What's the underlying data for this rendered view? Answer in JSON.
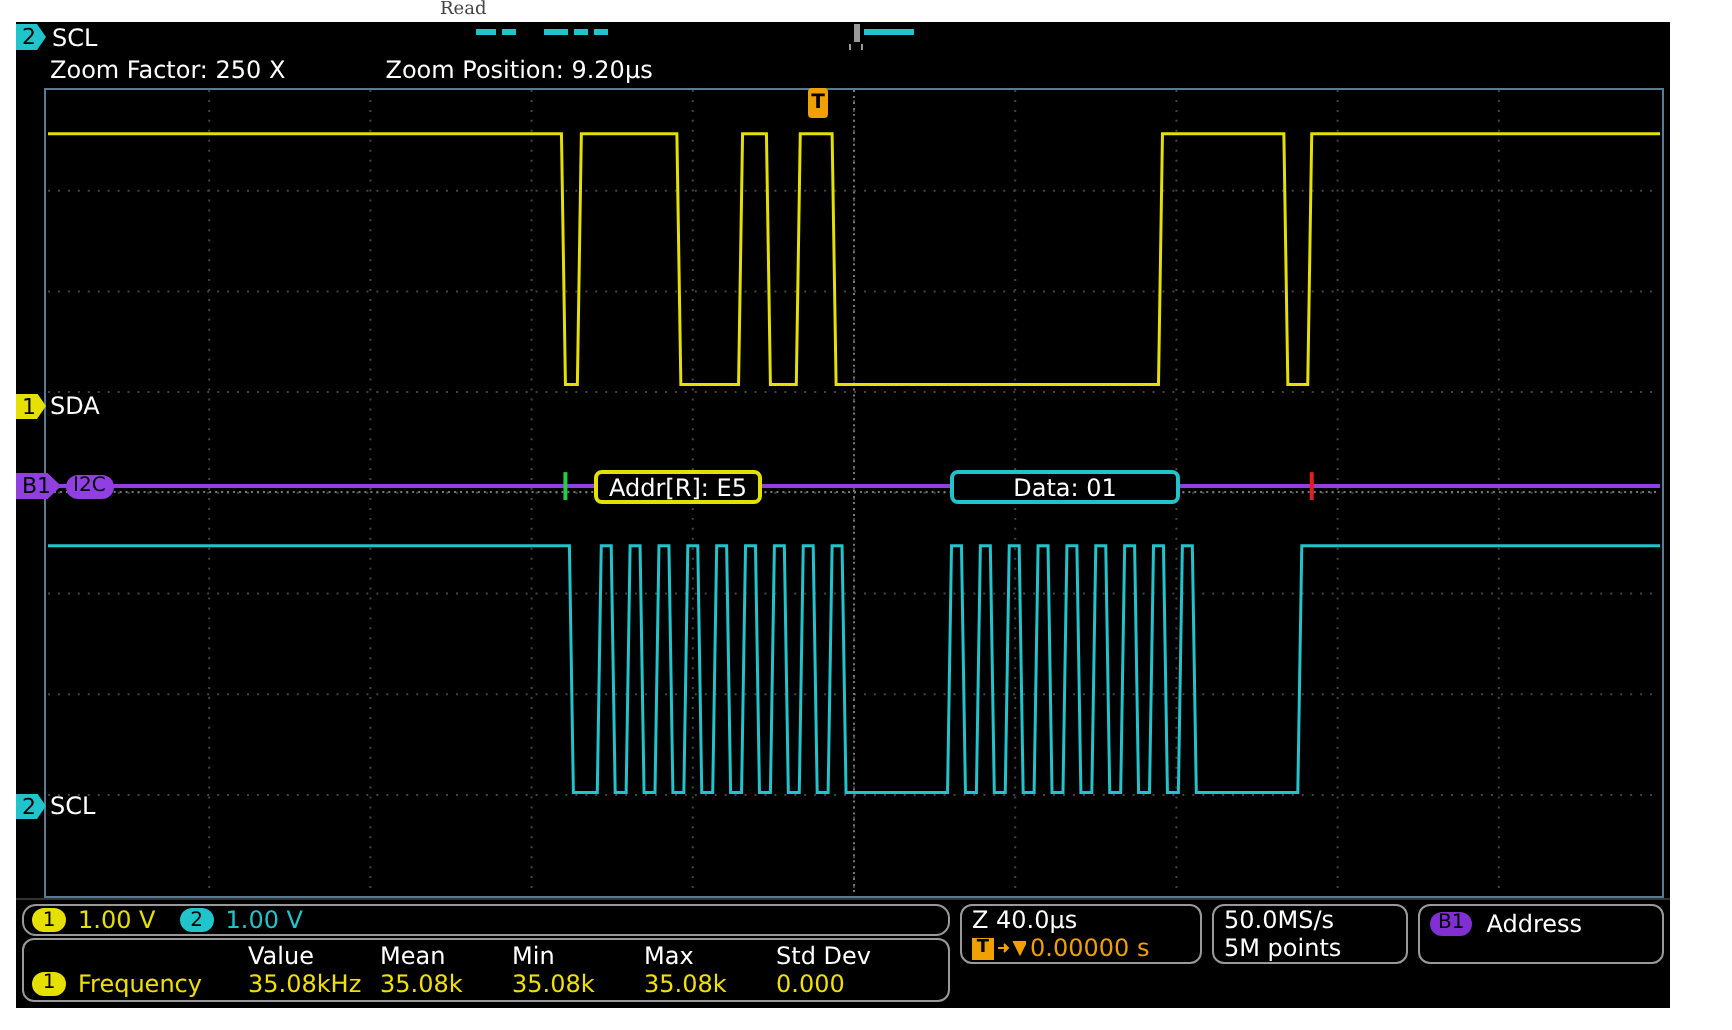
{
  "top_label": "Read",
  "overview": {
    "channel": "2",
    "label": "SCL"
  },
  "zoom": {
    "factor": "Zoom Factor: 250 X",
    "position": "Zoom Position: 9.20µs"
  },
  "trigger_marker": "T",
  "channels": [
    {
      "number": "1",
      "label": "SDA",
      "color": "#e6e000"
    },
    {
      "number": "2",
      "label": "SCL",
      "color": "#22c4cc"
    }
  ],
  "bus": {
    "number": "B1",
    "label": "I2C",
    "packets": [
      {
        "kind": "address",
        "text": "Addr[R]: E5",
        "color": "#e6e000"
      },
      {
        "kind": "data",
        "text": "Data: 01",
        "color": "#22c4cc"
      }
    ]
  },
  "scales": [
    {
      "number": "1",
      "value": "1.00 V",
      "color": "#e6e000"
    },
    {
      "number": "2",
      "value": "1.00 V",
      "color": "#22c4cc"
    }
  ],
  "measurement": {
    "headers": [
      "Value",
      "Mean",
      "Min",
      "Max",
      "Std Dev"
    ],
    "channel": "1",
    "name": "Frequency",
    "values": [
      "35.08kHz",
      "35.08k",
      "35.08k",
      "35.08k",
      "0.000"
    ]
  },
  "horizontal": {
    "scale": "Z 40.0µs",
    "trigger_icon": "T",
    "position": "0.00000 s"
  },
  "acquisition": {
    "rate": "50.0MS/s",
    "length": "5M points"
  },
  "bus_trigger": {
    "number": "B1",
    "label": "Address"
  }
}
